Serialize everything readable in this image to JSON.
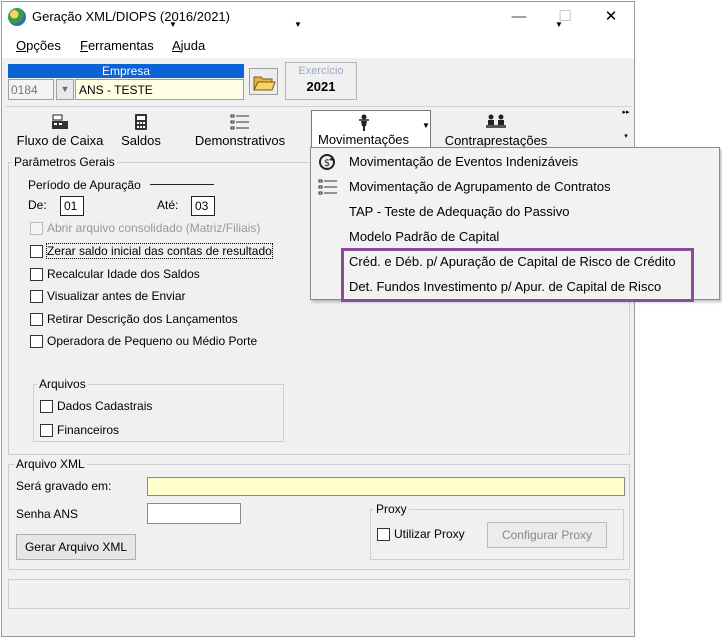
{
  "window": {
    "title": "Geração XML/DIOPS (2016/2021)",
    "controls": {
      "minimize": "—",
      "maximize": "☐",
      "close": "✕"
    }
  },
  "menubar": {
    "items": [
      {
        "first": "O",
        "rest": "pções"
      },
      {
        "first": "F",
        "rest": "erramentas"
      },
      {
        "first": "A",
        "rest": "juda"
      }
    ]
  },
  "empresa": {
    "label": "Empresa",
    "code": "0184",
    "name": "ANS - TESTE"
  },
  "exercicio": {
    "label": "Exercício",
    "value": "2021"
  },
  "toolbar": {
    "buttons": [
      {
        "label": "Fluxo de Caixa",
        "icon": "cash-register-icon"
      },
      {
        "label": "Saldos",
        "icon": "calculator-icon"
      },
      {
        "label": "Demonstrativos",
        "icon": "list-icon"
      },
      {
        "label": "Movimentações",
        "icon": "person-up-icon"
      },
      {
        "label": "Contraprestações",
        "icon": "group-icon"
      }
    ]
  },
  "parametros": {
    "title": "Parâmetros Gerais",
    "periodo_label": "Período de Apuração",
    "de_label": "De:",
    "de_value": "01",
    "ate_label": "Até:",
    "ate_value": "03",
    "options": [
      {
        "label": "Abrir arquivo consolidado (Matriz/Filiais)",
        "checked": false,
        "enabled": false
      },
      {
        "label": "Zerar saldo inicial das contas de resultado",
        "checked": false,
        "enabled": true,
        "focused": true
      },
      {
        "label": "Recalcular Idade dos Saldos",
        "checked": false,
        "enabled": true
      },
      {
        "label": "Visualizar antes de Enviar",
        "checked": false,
        "enabled": true
      },
      {
        "label": "Retirar Descrição dos Lançamentos",
        "checked": false,
        "enabled": true
      },
      {
        "label": "Operadora de Pequeno ou Médio Porte",
        "checked": false,
        "enabled": true
      }
    ],
    "arquivos": {
      "title": "Arquivos",
      "options": [
        {
          "label": "Dados Cadastrais",
          "checked": false
        },
        {
          "label": "Financeiros",
          "checked": false
        }
      ]
    }
  },
  "arquivo_xml": {
    "title": "Arquivo XML",
    "gravado_label": "Será gravado em:",
    "gravado_value": "",
    "senha_label": "Senha ANS",
    "senha_value": "",
    "gerar_button": "Gerar Arquivo XML",
    "proxy": {
      "title": "Proxy",
      "utilizar_label": "Utilizar Proxy",
      "configurar_button": "Configurar Proxy"
    }
  },
  "movimentacoes_menu": {
    "items": [
      {
        "label": "Movimentação de Eventos Indenizáveis",
        "icon": "refresh-dollar-icon"
      },
      {
        "label": "Movimentação de Agrupamento de Contratos",
        "icon": "list-icon"
      },
      {
        "label": "TAP - Teste de Adequação do Passivo",
        "icon": ""
      },
      {
        "label": "Modelo Padrão de Capital",
        "icon": ""
      },
      {
        "label": "Créd. e Déb. p/ Apuração de Capital de Risco de Crédito",
        "icon": ""
      },
      {
        "label": "Det. Fundos Investimento p/ Apur. de Capital de Risco",
        "icon": ""
      }
    ],
    "highlight_color": "#8d4ba0"
  },
  "colors": {
    "accent": "#0a64d6",
    "field_yellow": "#ffffe4",
    "path_field": "#ffffcc"
  }
}
